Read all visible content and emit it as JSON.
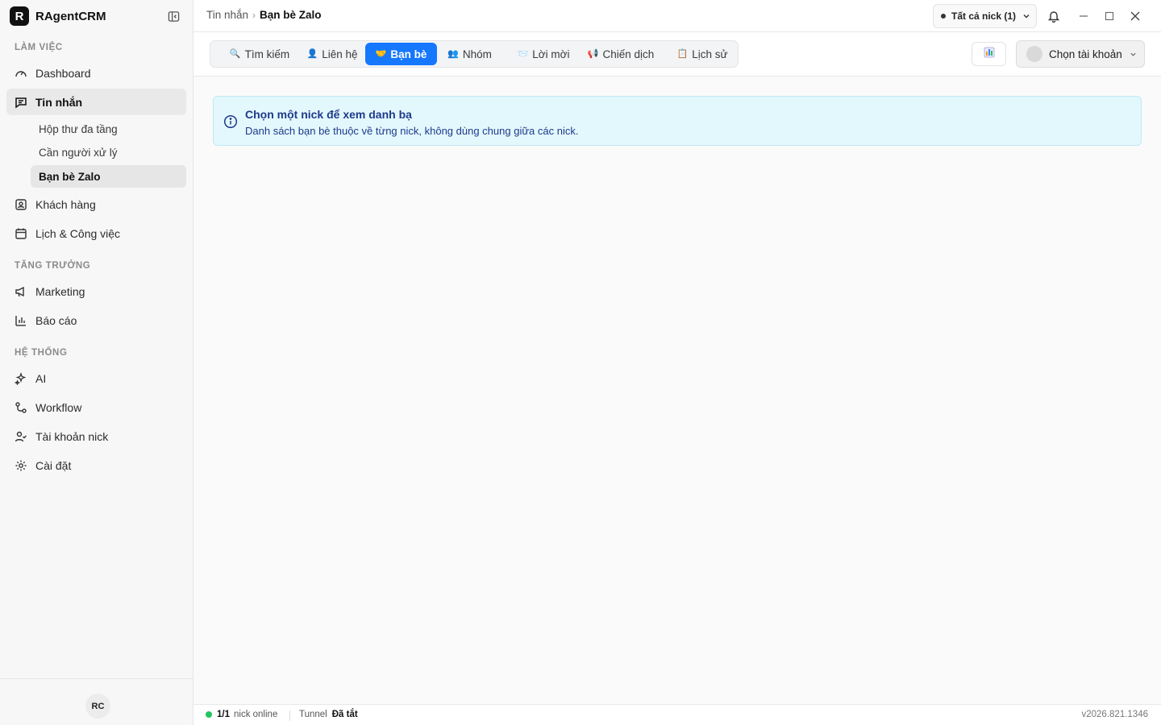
{
  "app": {
    "brand_letter": "R",
    "brand_name": "RAgentCRM"
  },
  "sidebar": {
    "sections": {
      "work": "LÀM VIỆC",
      "growth": "TĂNG TRƯỞNG",
      "system": "HỆ THỐNG"
    },
    "items": {
      "dashboard": "Dashboard",
      "messages": "Tin nhắn",
      "customers": "Khách hàng",
      "calendar": "Lịch & Công việc",
      "marketing": "Marketing",
      "reports": "Báo cáo",
      "ai": "AI",
      "workflow": "Workflow",
      "nick_accounts": "Tài khoản nick",
      "settings": "Cài đặt"
    },
    "sub_items": {
      "inbox": "Hộp thư đa tầng",
      "needs_handling": "Cần người xử lý",
      "zalo_friends": "Bạn bè Zalo"
    },
    "user_initials": "RC"
  },
  "topbar": {
    "breadcrumb_parent": "Tin nhắn",
    "breadcrumb_sep": "›",
    "breadcrumb_current": "Bạn bè Zalo",
    "nick_filter": "Tất cả nick (1)"
  },
  "tabs": {
    "search": {
      "icon": "🔍",
      "label": "Tìm kiếm"
    },
    "contacts": {
      "icon": "👤",
      "label": "Liên hệ"
    },
    "friends": {
      "icon": "🤝",
      "label": "Bạn bè"
    },
    "groups": {
      "icon": "👥",
      "label": "Nhóm"
    },
    "invites": {
      "icon": "📨",
      "label": "Lời mời"
    },
    "campaigns": {
      "icon": "📢",
      "label": "Chiến dịch"
    },
    "history": {
      "icon": "📋",
      "label": "Lịch sử"
    }
  },
  "account_select": {
    "placeholder": "Chọn tài khoản"
  },
  "alert": {
    "title": "Chọn một nick để xem danh bạ",
    "description": "Danh sách bạn bè thuộc về từng nick, không dùng chung giữa các nick."
  },
  "status": {
    "online_count": "1/1",
    "online_label": "nick online",
    "tunnel_label": "Tunnel",
    "tunnel_value": "Đã tắt",
    "version": "v2026.821.1346"
  },
  "colors": {
    "accent": "#1677ff",
    "alert_bg": "#e3f8fd",
    "alert_text": "#1e3a8a",
    "online": "#22c55e"
  }
}
